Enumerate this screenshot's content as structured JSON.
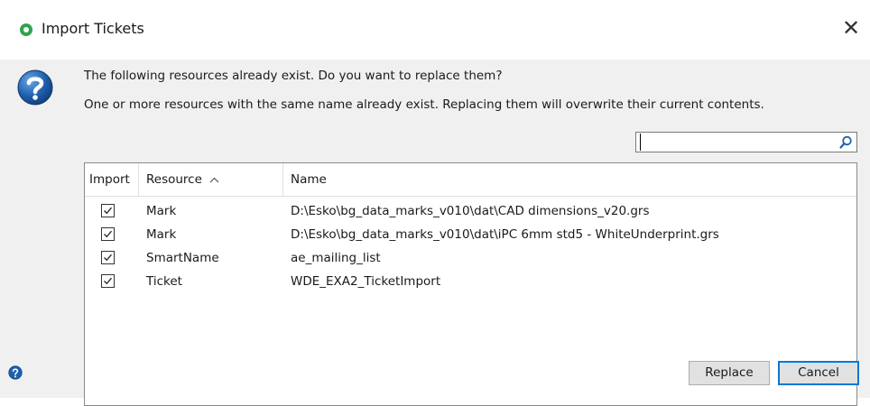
{
  "window": {
    "title": "Import Tickets",
    "close_glyph": "✕"
  },
  "message": {
    "line1": "The following resources already exist. Do you want to replace them?",
    "line2": "One or more resources with the same name already exist. Replacing them will overwrite their current contents.",
    "icon": "question-icon"
  },
  "search": {
    "value": "",
    "placeholder": ""
  },
  "table": {
    "columns": [
      "Import",
      "Resource",
      "Name"
    ],
    "sort_column": "Resource",
    "sort_glyph": "^",
    "rows": [
      {
        "checked": true,
        "resource": "Mark",
        "name": "D:\\Esko\\bg_data_marks_v010\\dat\\CAD dimensions_v20.grs"
      },
      {
        "checked": true,
        "resource": "Mark",
        "name": "D:\\Esko\\bg_data_marks_v010\\dat\\iPC 6mm std5 - WhiteUnderprint.grs"
      },
      {
        "checked": true,
        "resource": "SmartName",
        "name": "ae_mailing_list"
      },
      {
        "checked": true,
        "resource": "Ticket",
        "name": "WDE_EXA2_TicketImport"
      }
    ]
  },
  "buttons": {
    "replace": "Replace",
    "cancel": "Cancel"
  },
  "colors": {
    "accent": "#0078d7",
    "app_icon": "#2ea44f",
    "dialog_bg": "#f0f0f0"
  }
}
